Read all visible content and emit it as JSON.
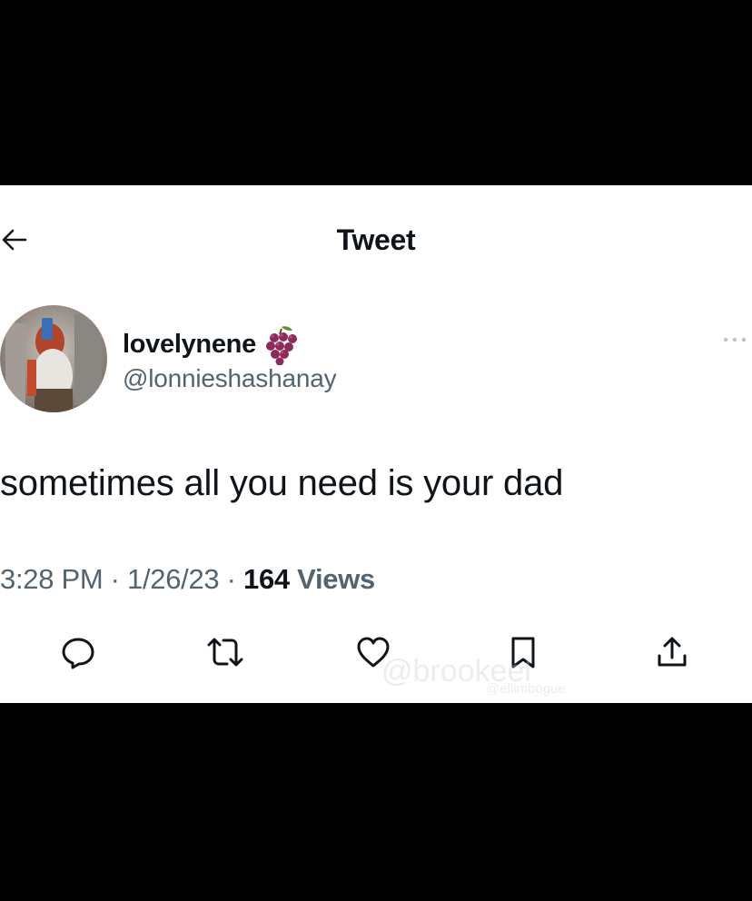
{
  "header": {
    "title": "Tweet",
    "back_icon": "back-arrow-icon"
  },
  "author": {
    "display_name": "lovelynene",
    "name_emoji": "grapes-emoji",
    "handle": "@lonnieshashanay",
    "more_icon": "more-dots-icon"
  },
  "tweet": {
    "text": "sometimes all you need is your dad",
    "time": "3:28 PM",
    "separator1": " · ",
    "date": "1/26/23",
    "separator2": " · ",
    "views_count": "164",
    "views_label": " Views"
  },
  "actions": [
    {
      "name": "reply",
      "icon": "reply-bubble-icon"
    },
    {
      "name": "retweet",
      "icon": "retweet-icon"
    },
    {
      "name": "like",
      "icon": "heart-icon"
    },
    {
      "name": "bookmark",
      "icon": "bookmark-icon"
    },
    {
      "name": "share",
      "icon": "share-upload-icon"
    }
  ],
  "watermark": {
    "main": "@brookeel",
    "sub": "@ellimbogue"
  },
  "colors": {
    "text_primary": "#0f1419",
    "text_secondary": "#536471",
    "background": "#ffffff",
    "letterbox": "#000000"
  }
}
